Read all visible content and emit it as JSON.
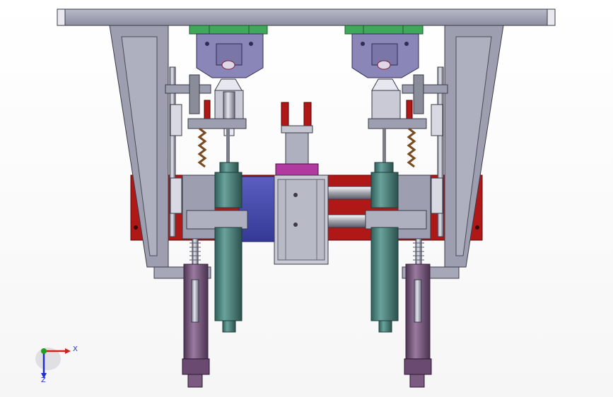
{
  "triad": {
    "x_label": "X",
    "z_label": "Z",
    "colors": {
      "x": "#d02020",
      "y": "#20a020",
      "z": "#2030d0"
    }
  },
  "palette": {
    "frame_gray": "#9d9fb0",
    "frame_dark": "#5a5c6b",
    "frame_light": "#c4c6d2",
    "rail_red": "#b01818",
    "guide_block_green": "#3fa85a",
    "head_lavender": "#8a86b8",
    "cylinder_teal": "#4f8c86",
    "rod_purple": "#7b5b80",
    "plate_blue": "#4a4ea8",
    "slide_gray": "#b8bac6",
    "accent_magenta": "#b03aa0"
  }
}
